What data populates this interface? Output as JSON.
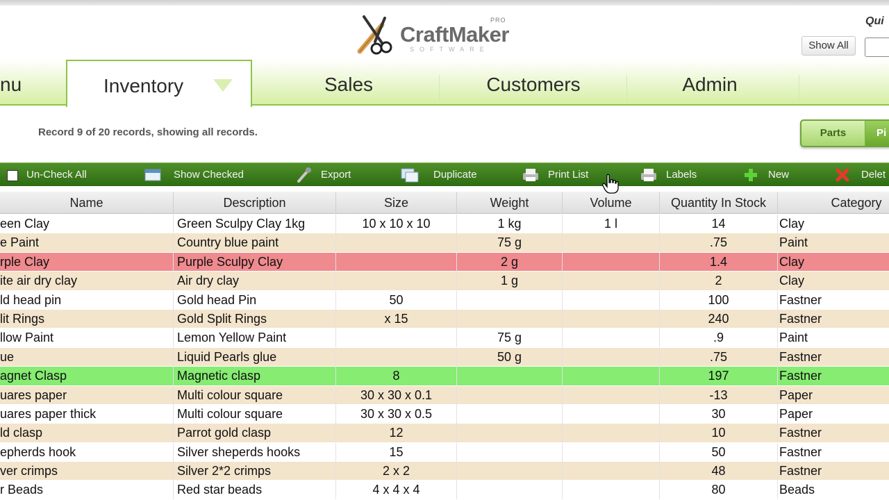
{
  "header": {
    "logo_text": "CraftMaker",
    "logo_pro": "PRO",
    "logo_sub": "SOFTWARE",
    "quick_label": "Qui",
    "show_all_label": "Show All"
  },
  "tabs": [
    {
      "label": "nu"
    },
    {
      "label": "Inventory"
    },
    {
      "label": "Sales"
    },
    {
      "label": "Customers"
    },
    {
      "label": "Admin"
    }
  ],
  "record_info": "Record 9 of 20 records, showing all records.",
  "view_toggle": {
    "parts_label": "Parts",
    "other_label": "Pi"
  },
  "toolbar": {
    "uncheck_all": "Un-Check All",
    "show_checked": "Show Checked",
    "export": "Export",
    "duplicate": "Duplicate",
    "print_list": "Print List",
    "labels": "Labels",
    "new": "New",
    "delete": "Delet"
  },
  "table": {
    "columns": [
      "Name",
      "Description",
      "Size",
      "Weight",
      "Volume",
      "Quantity In Stock",
      "Category"
    ],
    "rows": [
      {
        "name": "een Clay",
        "desc": "Green Sculpy Clay 1kg",
        "size": "10 x 10 x 10",
        "weight": "1 kg",
        "volume": "1 l",
        "qty": "14",
        "cat": "Clay",
        "style": "white"
      },
      {
        "name": "e Paint",
        "desc": "Country blue paint",
        "size": "",
        "weight": "75 g",
        "volume": "",
        "qty": ".75",
        "cat": "Paint",
        "style": "tan"
      },
      {
        "name": "rple Clay",
        "desc": "Purple Sculpy Clay",
        "size": "",
        "weight": "2 g",
        "volume": "",
        "qty": "1.4",
        "cat": "Clay",
        "style": "red"
      },
      {
        "name": "ite air dry clay",
        "desc": "Air dry clay",
        "size": "",
        "weight": "1 g",
        "volume": "",
        "qty": "2",
        "cat": "Clay",
        "style": "tan"
      },
      {
        "name": "ld head pin",
        "desc": "Gold head Pin",
        "size": "50",
        "weight": "",
        "volume": "",
        "qty": "100",
        "cat": "Fastner",
        "style": "white"
      },
      {
        "name": "lit Rings",
        "desc": "Gold Split Rings",
        "size": "x 15",
        "weight": "",
        "volume": "",
        "qty": "240",
        "cat": "Fastner",
        "style": "tan"
      },
      {
        "name": "llow Paint",
        "desc": "Lemon Yellow Paint",
        "size": "",
        "weight": "75 g",
        "volume": "",
        "qty": ".9",
        "cat": "Paint",
        "style": "white"
      },
      {
        "name": "ue",
        "desc": "Liquid Pearls glue",
        "size": "",
        "weight": "50 g",
        "volume": "",
        "qty": ".75",
        "cat": "Fastner",
        "style": "tan"
      },
      {
        "name": "agnet Clasp",
        "desc": "Magnetic clasp",
        "size": "8",
        "weight": "",
        "volume": "",
        "qty": "197",
        "cat": "Fastner",
        "style": "green"
      },
      {
        "name": "uares paper",
        "desc": "Multi colour square",
        "size": "30 x 30 x 0.1",
        "weight": "",
        "volume": "",
        "qty": "-13",
        "cat": "Paper",
        "style": "tan"
      },
      {
        "name": "uares paper thick",
        "desc": "Multi colour square",
        "size": "30 x 30 x 0.5",
        "weight": "",
        "volume": "",
        "qty": "30",
        "cat": "Paper",
        "style": "white"
      },
      {
        "name": "ld clasp",
        "desc": "Parrot gold clasp",
        "size": "12",
        "weight": "",
        "volume": "",
        "qty": "10",
        "cat": "Fastner",
        "style": "tan"
      },
      {
        "name": "epherds hook",
        "desc": "Silver sheperds hooks",
        "size": "15",
        "weight": "",
        "volume": "",
        "qty": "50",
        "cat": "Fastner",
        "style": "white"
      },
      {
        "name": "ver crimps",
        "desc": "Silver 2*2 crimps",
        "size": "2 x 2",
        "weight": "",
        "volume": "",
        "qty": "48",
        "cat": "Fastner",
        "style": "tan"
      },
      {
        "name": "r Beads",
        "desc": "Red star beads",
        "size": "4 x 4 x 4",
        "weight": "",
        "volume": "",
        "qty": "80",
        "cat": "Beads",
        "style": "white"
      }
    ]
  },
  "colors": {
    "accent_green": "#8dc449",
    "toolbar_green": "#3e7d1e",
    "row_tan": "#f3e4cc",
    "row_red": "#ef8a8e",
    "row_green": "#86ec72"
  }
}
